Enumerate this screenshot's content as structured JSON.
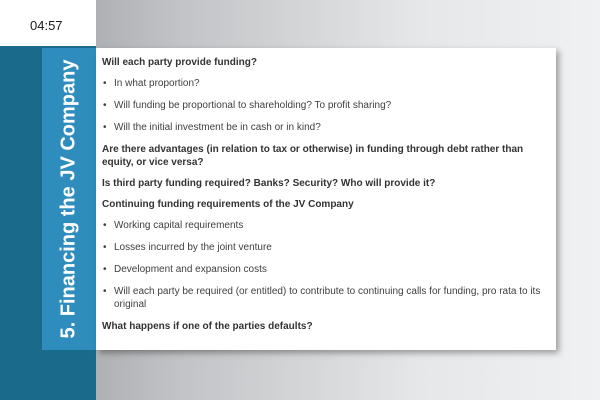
{
  "timer": "04:57",
  "slide": {
    "title": "5. Financing the JV Company",
    "blocks": [
      {
        "type": "heading",
        "text": "Will each party provide funding?"
      },
      {
        "type": "bullet",
        "text": "In what proportion?"
      },
      {
        "type": "bullet",
        "text": "Will funding be proportional to shareholding? To profit sharing?"
      },
      {
        "type": "bullet",
        "text": "Will the initial investment be in cash or in kind?"
      },
      {
        "type": "heading",
        "text": "Are there advantages (in relation to tax or otherwise) in funding through debt rather than equity, or vice versa?"
      },
      {
        "type": "heading",
        "text": "Is third party funding required? Banks? Security? Who will provide it?"
      },
      {
        "type": "heading",
        "text": "Continuing funding requirements of the JV Company"
      },
      {
        "type": "bullet",
        "text": "Working capital requirements"
      },
      {
        "type": "bullet",
        "text": "Losses incurred by the joint venture"
      },
      {
        "type": "bullet",
        "text": "Development and expansion costs"
      },
      {
        "type": "bullet",
        "text": "Will each party be required (or entitled) to contribute to continuing calls for funding, pro rata to its original"
      },
      {
        "type": "heading",
        "text": "What happens if one of the parties defaults?"
      }
    ]
  },
  "colors": {
    "accent_blue": "#2f8dbd",
    "dark_teal": "#1a6a8c"
  },
  "icons": {
    "bullet": "bullet-dot-icon"
  }
}
